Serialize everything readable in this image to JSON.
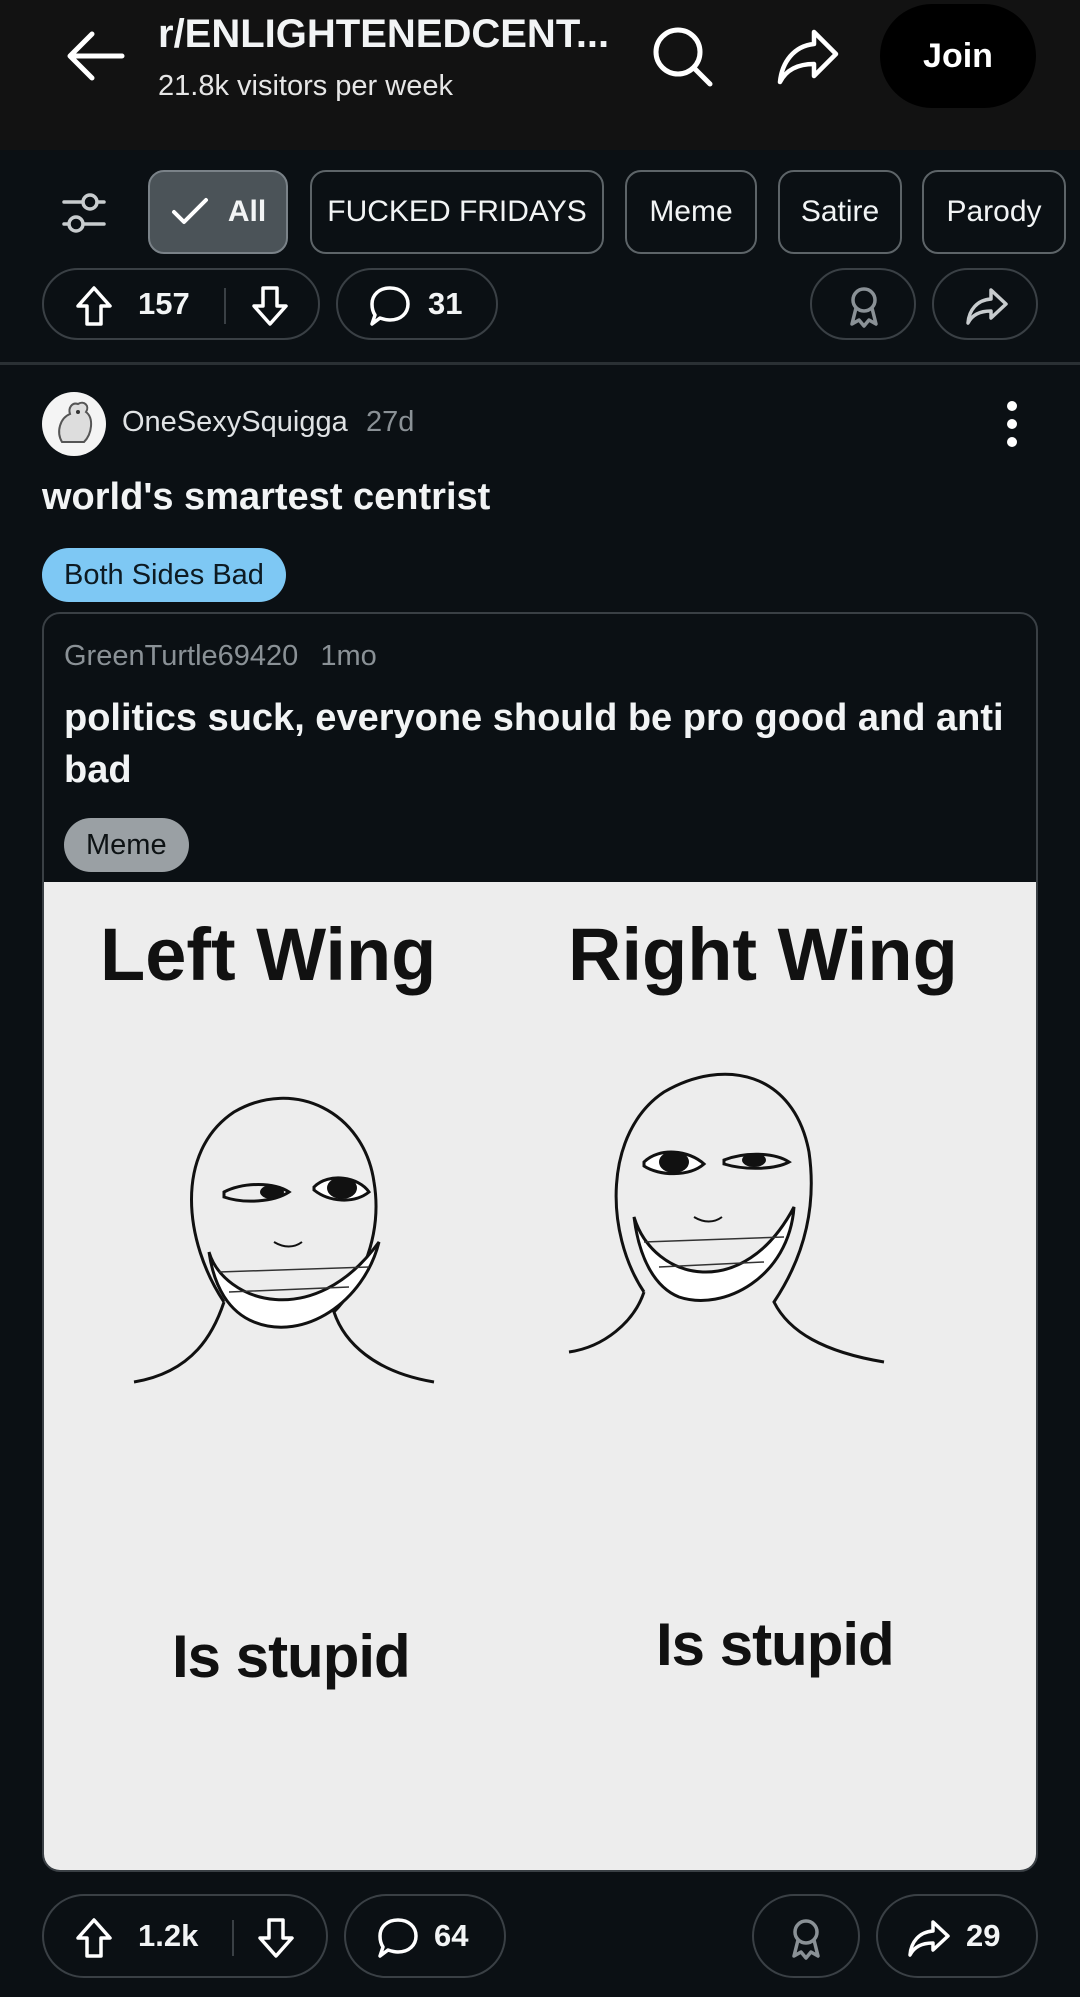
{
  "header": {
    "title": "r/ENLIGHTENEDCENT...",
    "subtitle": "21.8k visitors per week",
    "join_label": "Join"
  },
  "filters": [
    {
      "label": "All",
      "active": true
    },
    {
      "label": "FUCKED FRIDAYS",
      "active": false
    },
    {
      "label": "Meme",
      "active": false
    },
    {
      "label": "Satire",
      "active": false
    },
    {
      "label": "Parody",
      "active": false
    }
  ],
  "prev_post": {
    "upvotes": "157",
    "comments": "31"
  },
  "post": {
    "author": "OneSexySquigga",
    "age": "27d",
    "title": "world's smartest centrist",
    "flair": "Both Sides Bad",
    "crosspost": {
      "author": "GreenTurtle69420",
      "age": "1mo",
      "title": "politics suck, everyone should be pro good and anti bad",
      "flair": "Meme",
      "meme": {
        "left_heading": "Left Wing",
        "right_heading": "Right Wing",
        "left_caption": "Is stupid",
        "right_caption": "Is stupid"
      }
    },
    "upvotes": "1.2k",
    "comments": "64",
    "shares": "29"
  },
  "colors": {
    "background": "#0b1014",
    "flair_blue": "#7ec8f4",
    "chip_active": "#4b5358"
  },
  "icons": [
    "back-arrow-icon",
    "search-icon",
    "share-icon",
    "filter-icon",
    "check-icon",
    "upvote-icon",
    "downvote-icon",
    "comment-icon",
    "award-icon",
    "more-icon"
  ]
}
